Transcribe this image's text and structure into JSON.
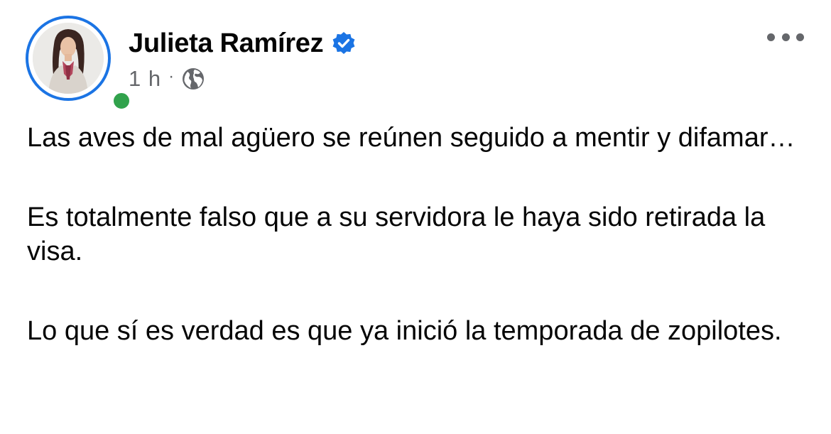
{
  "post": {
    "author": {
      "name": "Julieta Ramírez",
      "verified": true,
      "online": true,
      "avatar_icon": "profile-photo"
    },
    "meta": {
      "time": "1 h",
      "separator": "·",
      "audience_icon": "globe-icon"
    },
    "more_icon": "more-options-icon",
    "paragraphs": [
      "Las aves de mal agüero se reúnen seguido a mentir y difamar…",
      "Es totalmente falso que a su servidora le haya sido retirada la visa.",
      "Lo que sí es verdad es que ya inició la temporada de zopilotes."
    ]
  },
  "colors": {
    "accent_blue": "#1b74e4",
    "online_green": "#31a24c",
    "secondary_text": "#65676b",
    "primary_text": "#050505"
  }
}
